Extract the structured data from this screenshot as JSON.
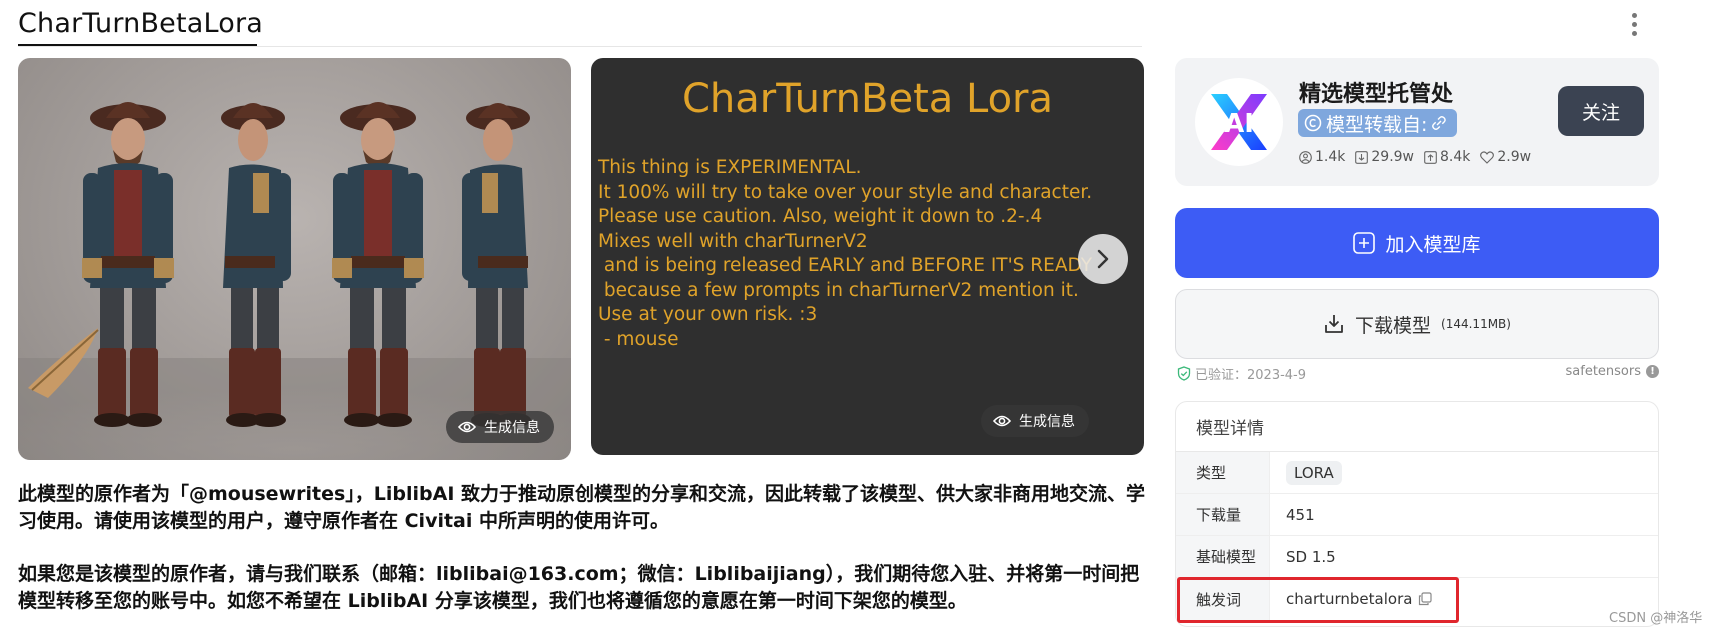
{
  "page": {
    "title": "CharTurnBetaLora"
  },
  "carousel": {
    "gen_info_label": "生成信息",
    "poster": {
      "title": "CharTurnBeta Lora",
      "lines": [
        "This thing is EXPERIMENTAL.",
        "",
        "It 100% will try to take over your style and character.",
        "Please use caution. Also, weight it down to .2-.4",
        "",
        "Mixes well with charTurnerV2",
        " and is being released EARLY and BEFORE IT'S READY",
        " because a few prompts in charTurnerV2 mention it.",
        "",
        "Use at your own risk. :3",
        "",
        " - mouse"
      ]
    }
  },
  "description": {
    "para1": "此模型的原作者为「@mousewrites」，LiblibAI 致力于推动原创模型的分享和交流，因此转载了该模型、供大家非商用地交流、学习使用。请使用该模型的用户，遵守原作者在 Civitai 中所声明的使用许可。",
    "para2": "如果您是该模型的原作者，请与我们联系（邮箱：liblibai@163.com；微信：Liblibaijiang），我们期待您入驻、并将第一时间把模型转移至您的账号中。如您不希望在 LiblibAI 分享该模型，我们也将遵循您的意愿在第一时间下架您的模型。"
  },
  "author": {
    "name": "精选模型托管处",
    "avatar_text": "AI",
    "badge": "模型转载自:",
    "stats": {
      "followers": "1.4k",
      "downloads": "29.9w",
      "uploads": "8.4k",
      "likes": "2.9w"
    },
    "follow_label": "关注"
  },
  "actions": {
    "add_library": "加入模型库",
    "download": "下载模型",
    "download_size": "(144.11MB)"
  },
  "verification": {
    "text": "已验证：2023-4-9",
    "format": "safetensors"
  },
  "details": {
    "heading": "模型详情",
    "rows": [
      {
        "key": "类型",
        "value": "LORA"
      },
      {
        "key": "下载量",
        "value": "451"
      },
      {
        "key": "基础模型",
        "value": "SD 1.5"
      },
      {
        "key": "触发词",
        "value": "charturnbetalora"
      }
    ]
  },
  "watermark": "CSDN @神洛华",
  "colors": {
    "primary": "#3d5cf5",
    "follow": "#3b4352",
    "poster_text": "#e0a32a",
    "highlight": "#e0262d"
  }
}
